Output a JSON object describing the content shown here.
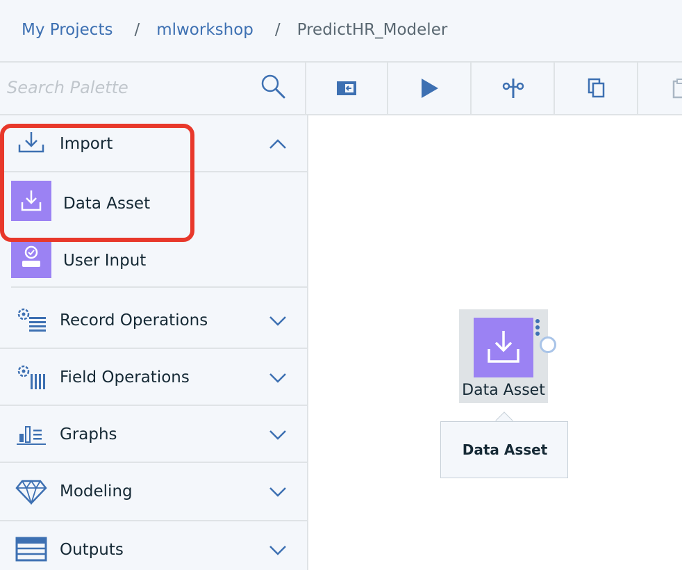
{
  "breadcrumb": {
    "items": [
      "My Projects",
      "mlworkshop",
      "PredictHR_Modeler"
    ],
    "separator": "/"
  },
  "palette": {
    "search": {
      "placeholder": "Search Palette",
      "value": "",
      "icon": "search-icon"
    },
    "categories": [
      {
        "label": "Import",
        "icon": "import-icon",
        "expanded": true,
        "nodes": [
          {
            "label": "Data Asset",
            "icon": "download-icon"
          },
          {
            "label": "User Input",
            "icon": "user-input-icon"
          }
        ]
      },
      {
        "label": "Record Operations",
        "icon": "record-operations-icon",
        "expanded": false
      },
      {
        "label": "Field Operations",
        "icon": "field-operations-icon",
        "expanded": false
      },
      {
        "label": "Graphs",
        "icon": "graphs-icon",
        "expanded": false
      },
      {
        "label": "Modeling",
        "icon": "modeling-diamond-icon",
        "expanded": false
      },
      {
        "label": "Outputs",
        "icon": "outputs-table-icon",
        "expanded": false
      }
    ]
  },
  "toolbar": {
    "buttons": [
      "toggle-palette-icon",
      "run-icon",
      "cut-icon",
      "copy-icon",
      "paste-icon"
    ]
  },
  "canvas": {
    "node": {
      "label": "Data Asset",
      "icon": "download-icon"
    },
    "tooltip": "Data Asset"
  },
  "colors": {
    "node_purple": "#9b82f3",
    "link_blue": "#3d70b2",
    "highlight_red": "#e8382b",
    "panel_bg": "#f4f7fb"
  }
}
